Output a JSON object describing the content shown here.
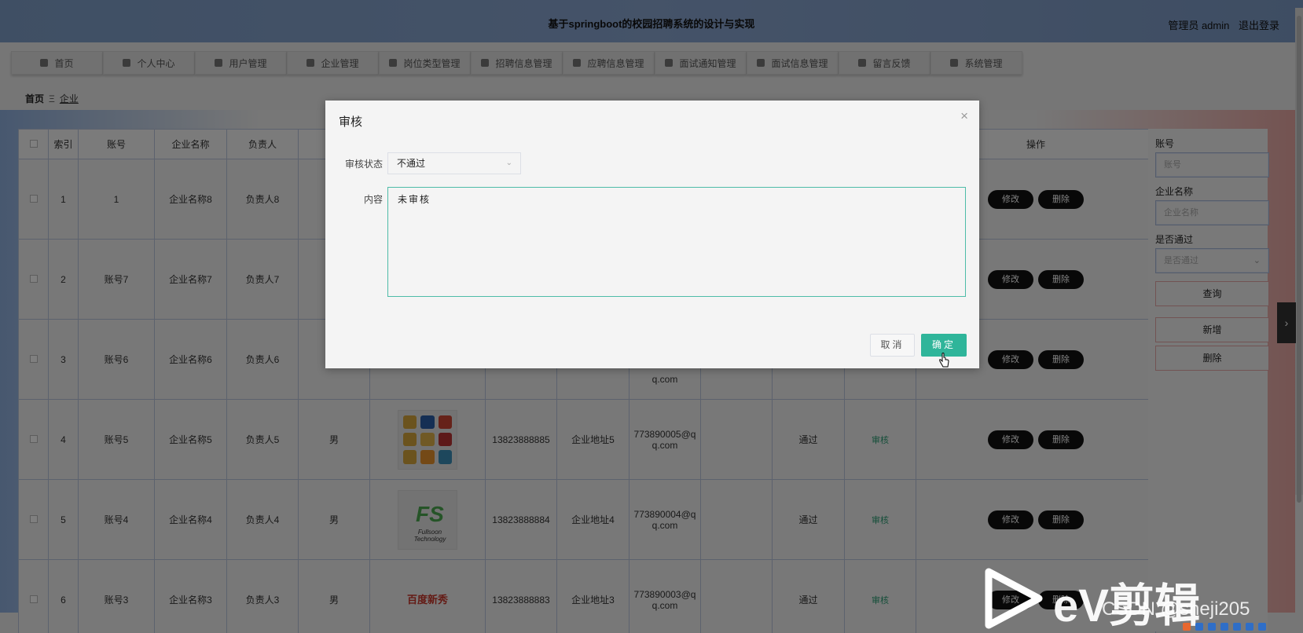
{
  "header": {
    "title": "基于springboot的校园招聘系统的设计与实现",
    "user_label": "管理员 admin",
    "logout_label": "退出登录"
  },
  "nav": [
    {
      "label": "首页",
      "icon": "home-icon"
    },
    {
      "label": "个人中心",
      "icon": "user-icon"
    },
    {
      "label": "用户管理",
      "icon": "grid-icon"
    },
    {
      "label": "企业管理",
      "icon": "clipboard-icon"
    },
    {
      "label": "岗位类型管理",
      "icon": "list-icon"
    },
    {
      "label": "招聘信息管理",
      "icon": "grid-icon"
    },
    {
      "label": "应聘信息管理",
      "icon": "pin-icon"
    },
    {
      "label": "面试通知管理",
      "icon": "monitor-icon"
    },
    {
      "label": "面试信息管理",
      "icon": "briefcase-icon"
    },
    {
      "label": "留言反馈",
      "icon": "thumb-icon"
    },
    {
      "label": "系统管理",
      "icon": "user-icon"
    }
  ],
  "breadcrumb": {
    "home": "首页",
    "separator": "Ξ",
    "current": "企业"
  },
  "table": {
    "headers": [
      "",
      "索引",
      "账号",
      "企业名称",
      "负责人",
      "",
      "",
      "",
      "",
      "",
      "",
      "",
      "操作"
    ],
    "rows": [
      {
        "index": "1",
        "account": "1",
        "name": "企业名称8",
        "owner": "负责人8",
        "gender": "",
        "phone": "",
        "address": "",
        "email_1": "",
        "email_2": "",
        "status": "",
        "audit": ""
      },
      {
        "index": "2",
        "account": "账号7",
        "name": "企业名称7",
        "owner": "负责人7",
        "gender": "",
        "phone": "",
        "address": "",
        "email_1": "",
        "email_2": "",
        "status": "",
        "audit": ""
      },
      {
        "index": "3",
        "account": "账号6",
        "name": "企业名称6",
        "owner": "负责人6",
        "gender": "",
        "phone": "",
        "address": "",
        "email_1": "",
        "email_2": "q.com",
        "status": "",
        "audit": ""
      },
      {
        "index": "4",
        "account": "账号5",
        "name": "企业名称5",
        "owner": "负责人5",
        "gender": "男",
        "phone": "13823888885",
        "address": "企业地址5",
        "email_1": "773890005@q",
        "email_2": "q.com",
        "status": "通过",
        "audit": "审核"
      },
      {
        "index": "5",
        "account": "账号4",
        "name": "企业名称4",
        "owner": "负责人4",
        "gender": "男",
        "phone": "13823888884",
        "address": "企业地址4",
        "email_1": "773890004@q",
        "email_2": "q.com",
        "status": "通过",
        "audit": "审核"
      },
      {
        "index": "6",
        "account": "账号3",
        "name": "企业名称3",
        "owner": "负责人3",
        "gender": "男",
        "phone": "13823888883",
        "address": "企业地址3",
        "email_1": "773890003@q",
        "email_2": "q.com",
        "status": "通过",
        "audit": "审核"
      }
    ],
    "edit_label": "修改",
    "delete_label": "删除",
    "logo_fs_text": "FS",
    "logo_fs_sub": "Fullsoon Technology",
    "logo_bg_text": "百度新秀"
  },
  "search": {
    "account_label": "账号",
    "account_placeholder": "账号",
    "company_label": "企业名称",
    "company_placeholder": "企业名称",
    "passed_label": "是否通过",
    "passed_placeholder": "是否通过",
    "query_label": "查询",
    "add_label": "新增",
    "delete_label": "删除"
  },
  "dialog": {
    "title": "审核",
    "close_glyph": "×",
    "status_label": "审核状态",
    "status_value": "不通过",
    "content_label": "内容",
    "content_value": "未审核",
    "cancel_label": "取消",
    "ok_label": "确定"
  },
  "watermark": {
    "brand": "eV剪辑",
    "csdn": "CSDN @sheji205"
  },
  "colors": {
    "header_bg": "#8aa6d1",
    "confirm_button": "#2fb59a",
    "textarea_border": "#4ebca8",
    "audit_link": "#2a9d73"
  }
}
